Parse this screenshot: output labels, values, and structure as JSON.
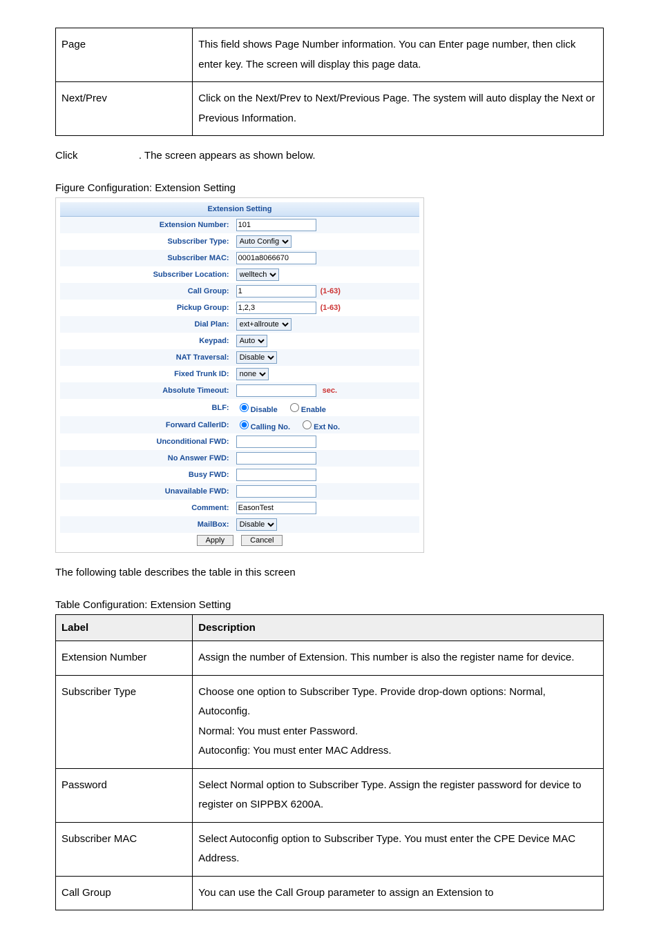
{
  "table1": {
    "rows": [
      {
        "label": "Page",
        "desc": "This field shows Page Number information. You can Enter page number, then click enter key. The screen will display this page data."
      },
      {
        "label": "Next/Prev",
        "desc": "Click on the Next/Prev to Next/Previous Page. The system will auto display the Next or Previous Information."
      }
    ]
  },
  "click_line_prefix": "Click",
  "click_line_suffix": ". The screen appears as shown below.",
  "figure_caption": "Figure Configuration: Extension Setting",
  "ext_form": {
    "header": "Extension Setting",
    "extension_number": {
      "label": "Extension Number:",
      "value": "101"
    },
    "subscriber_type": {
      "label": "Subscriber Type:",
      "value": "Auto Config"
    },
    "subscriber_mac": {
      "label": "Subscriber MAC:",
      "value": "0001a8066670"
    },
    "subscriber_location": {
      "label": "Subscriber Location:",
      "value": "welltech"
    },
    "call_group": {
      "label": "Call Group:",
      "value": "1",
      "hint": "(1-63)"
    },
    "pickup_group": {
      "label": "Pickup Group:",
      "value": "1,2,3",
      "hint": "(1-63)"
    },
    "dial_plan": {
      "label": "Dial Plan:",
      "value": "ext+allroute"
    },
    "keypad": {
      "label": "Keypad:",
      "value": "Auto"
    },
    "nat_traversal": {
      "label": "NAT Traversal:",
      "value": "Disable"
    },
    "fixed_trunk": {
      "label": "Fixed Trunk ID:",
      "value": "none"
    },
    "absolute_timeout": {
      "label": "Absolute Timeout:",
      "value": "",
      "unit": "sec."
    },
    "blf": {
      "label": "BLF:",
      "opt1": "Disable",
      "opt2": "Enable"
    },
    "forward_callerid": {
      "label": "Forward CallerID:",
      "opt1": "Calling No.",
      "opt2": "Ext No."
    },
    "unconditional_fwd": {
      "label": "Unconditional FWD:",
      "value": ""
    },
    "no_answer_fwd": {
      "label": "No Answer FWD:",
      "value": ""
    },
    "busy_fwd": {
      "label": "Busy FWD:",
      "value": ""
    },
    "unavailable_fwd": {
      "label": "Unavailable FWD:",
      "value": ""
    },
    "comment": {
      "label": "Comment:",
      "value": "EasonTest"
    },
    "mailbox": {
      "label": "MailBox:",
      "value": "Disable"
    },
    "apply_btn": "Apply",
    "cancel_btn": "Cancel"
  },
  "following_text": "The following table describes the table in this screen",
  "table2_caption": "Table   Configuration: Extension Setting",
  "table2": {
    "head_label": "Label",
    "head_desc": "Description",
    "rows": [
      {
        "label": "Extension Number",
        "desc": "Assign the number of Extension. This number is also the register name for device."
      },
      {
        "label": "Subscriber Type",
        "desc": "Choose one option to Subscriber Type. Provide drop-down options: Normal, Autoconfig.\nNormal: You must enter Password.\nAutoconfig: You must enter MAC Address."
      },
      {
        "label": "Password",
        "desc": "Select Normal option to Subscriber Type. Assign the register password for device to register on SIPPBX 6200A."
      },
      {
        "label": "Subscriber MAC",
        "desc": "Select Autoconfig option to Subscriber Type. You must enter the CPE Device MAC Address."
      },
      {
        "label": "Call Group",
        "desc": "You can use the Call Group parameter to assign an Extension to"
      }
    ]
  }
}
